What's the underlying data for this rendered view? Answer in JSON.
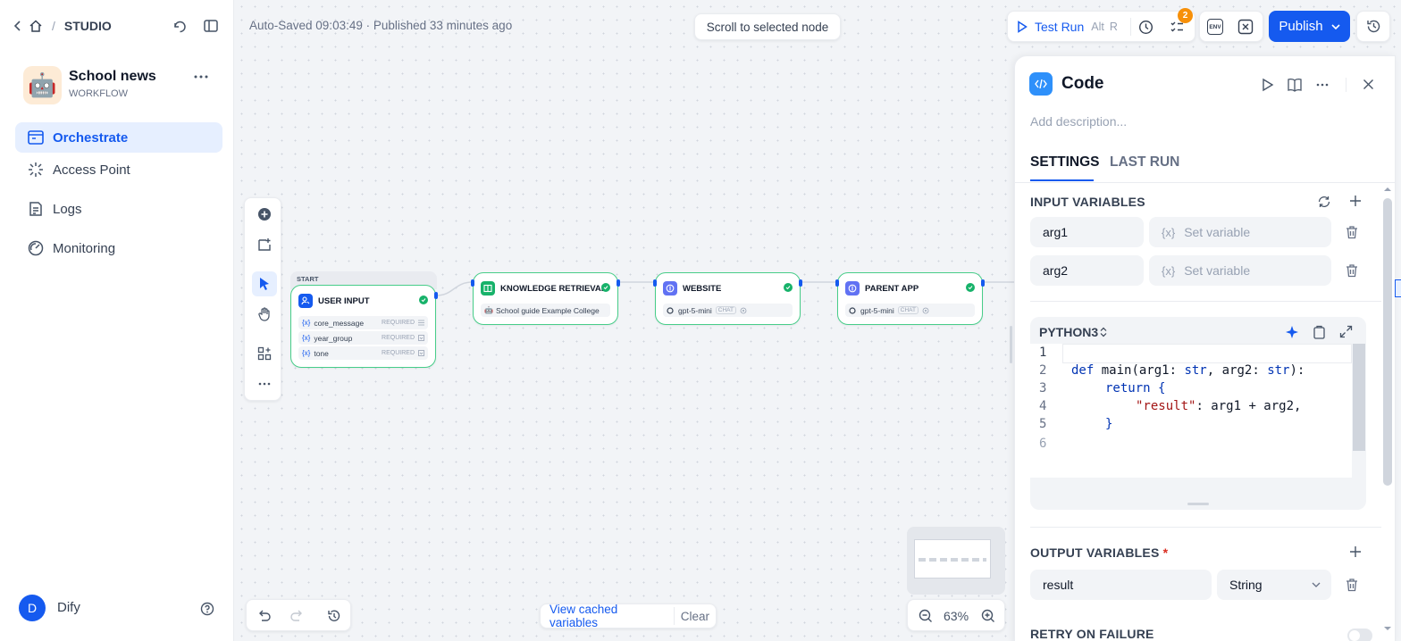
{
  "sidebar": {
    "breadcrumb": "STUDIO",
    "app_name": "School news",
    "app_type": "WORKFLOW",
    "nav": [
      {
        "label": "Orchestrate",
        "icon": "orchestrate-icon",
        "active": true
      },
      {
        "label": "Access Point",
        "icon": "access-point-icon"
      },
      {
        "label": "Logs",
        "icon": "logs-icon"
      },
      {
        "label": "Monitoring",
        "icon": "monitoring-icon"
      }
    ],
    "user_initial": "D",
    "user_name": "Dify"
  },
  "topbar": {
    "status": "Auto-Saved 09:03:49 · Published 33 minutes ago",
    "scroll_btn": "Scroll to selected node",
    "test_run": "Test Run",
    "shortcut_alt": "Alt",
    "shortcut_r": "R",
    "checklist_count": "2",
    "env_label": "ENV",
    "publish": "Publish"
  },
  "nodes": {
    "start_label": "START",
    "user_input": {
      "title": "USER INPUT",
      "vars": [
        {
          "name": "core_message",
          "req": "REQUIRED"
        },
        {
          "name": "year_group",
          "req": "REQUIRED"
        },
        {
          "name": "tone",
          "req": "REQUIRED"
        }
      ]
    },
    "knowledge": {
      "title": "KNOWLEDGE RETRIEVAL",
      "item": "School guide Example College"
    },
    "website": {
      "title": "WEBSITE",
      "model": "gpt-5-mini",
      "mode": "CHAT"
    },
    "parent_app": {
      "title": "PARENT APP",
      "model": "gpt-5-mini",
      "mode": "CHAT"
    },
    "var_prefix": "{x}"
  },
  "bottom": {
    "view_cached": "View cached variables",
    "clear": "Clear",
    "zoom": "63%"
  },
  "panel": {
    "title": "Code",
    "description_placeholder": "Add description...",
    "tabs": [
      "SETTINGS",
      "LAST RUN"
    ],
    "input_title": "INPUT VARIABLES",
    "inputs": [
      {
        "name": "arg1",
        "value_placeholder": "Set variable"
      },
      {
        "name": "arg2",
        "value_placeholder": "Set variable"
      }
    ],
    "var_prefix": "{x}",
    "language": "PYTHON3",
    "code_line_numbers": [
      "1",
      "2",
      "3",
      "4",
      "5",
      "6"
    ],
    "code": {
      "l2_def": "def",
      "l2_rest": " main(arg1: ",
      "l2_t1": "str",
      "l2_mid": ", arg2: ",
      "l2_t2": "str",
      "l2_end": "):",
      "l3_kw": "return",
      "l3_brace": " {",
      "l4_key": "\"result\"",
      "l4_rest": ": arg1 + arg2,",
      "l5": "}"
    },
    "output_title": "OUTPUT VARIABLES",
    "required_star": "*",
    "output_name": "result",
    "output_type": "String",
    "retry_title": "RETRY ON FAILURE"
  }
}
